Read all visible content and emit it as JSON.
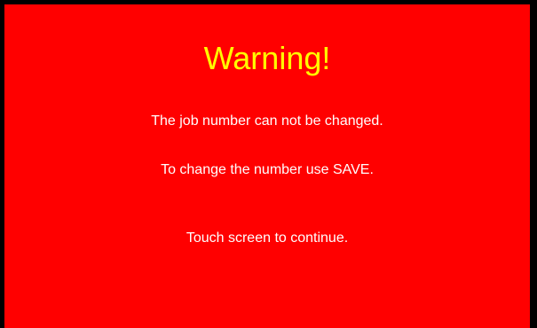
{
  "colors": {
    "background": "#FF0000",
    "border": "#000000",
    "title": "#FFFF00",
    "text": "#FFFFFF"
  },
  "dialog": {
    "title": "Warning!",
    "message_line_1": "The job number can not be changed.",
    "message_line_2": "To change the number use SAVE.",
    "instruction": "Touch screen to continue."
  }
}
